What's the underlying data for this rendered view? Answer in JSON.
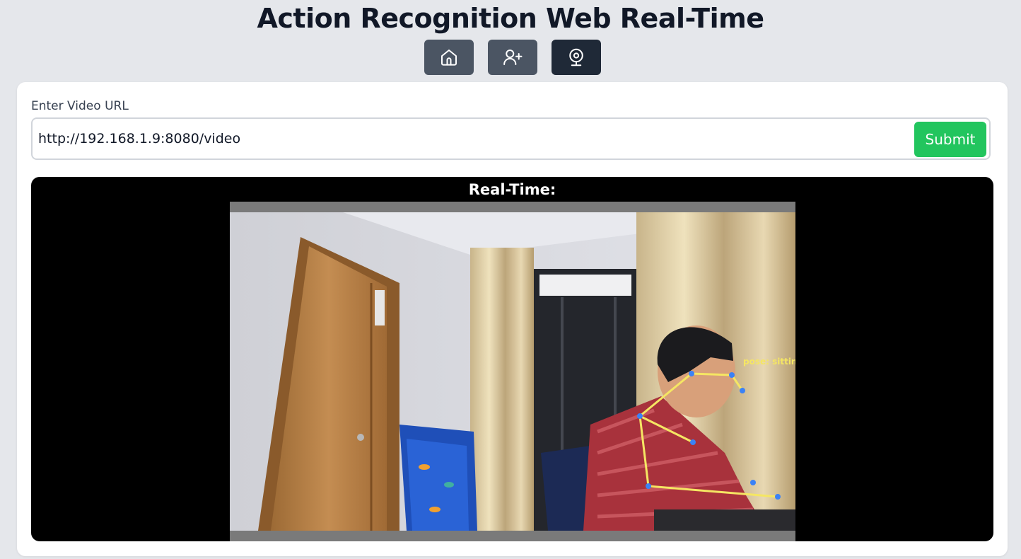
{
  "header": {
    "title": "Action Recognition Web Real-Time"
  },
  "nav": {
    "buttons": [
      {
        "icon": "home-icon",
        "active": false
      },
      {
        "icon": "user-plus-icon",
        "active": false
      },
      {
        "icon": "webcam-icon",
        "active": true
      }
    ]
  },
  "form": {
    "label": "Enter Video URL",
    "url_value": "http://192.168.1.9:8080/video",
    "submit_label": "Submit"
  },
  "stream": {
    "label": "Real-Time:",
    "pose_text": "pose: sitting"
  },
  "colors": {
    "background": "#e5e7eb",
    "nav_button": "#4b5563",
    "nav_button_active": "#1f2937",
    "submit": "#22c55e",
    "skeleton": "#f5e663",
    "keypoint": "#3b82f6"
  }
}
